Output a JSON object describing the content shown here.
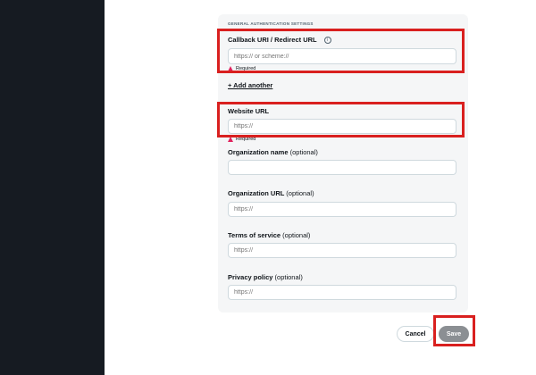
{
  "section_title": "GENERAL AUTHENTICATION SETTINGS",
  "callback": {
    "label": "Callback URI / Redirect URL",
    "placeholder": "https:// or scheme://",
    "required": "Required",
    "info_icon": "info-icon"
  },
  "add_another": "+ Add another",
  "website": {
    "label": "Website URL",
    "placeholder": "https://",
    "required": "Required"
  },
  "organization_name": {
    "label": "Organization name",
    "optional": "(optional)",
    "placeholder": ""
  },
  "organization_url": {
    "label": "Organization URL",
    "optional": "(optional)",
    "placeholder": "https://"
  },
  "terms": {
    "label": "Terms of service",
    "optional": "(optional)",
    "placeholder": "https://"
  },
  "privacy": {
    "label": "Privacy policy",
    "optional": "(optional)",
    "placeholder": "https://"
  },
  "buttons": {
    "cancel": "Cancel",
    "save": "Save"
  },
  "colors": {
    "highlight": "#d9201f",
    "left_rail": "#161b22",
    "save_disabled": "#8b8f93",
    "required_icon": "#e0245e"
  }
}
